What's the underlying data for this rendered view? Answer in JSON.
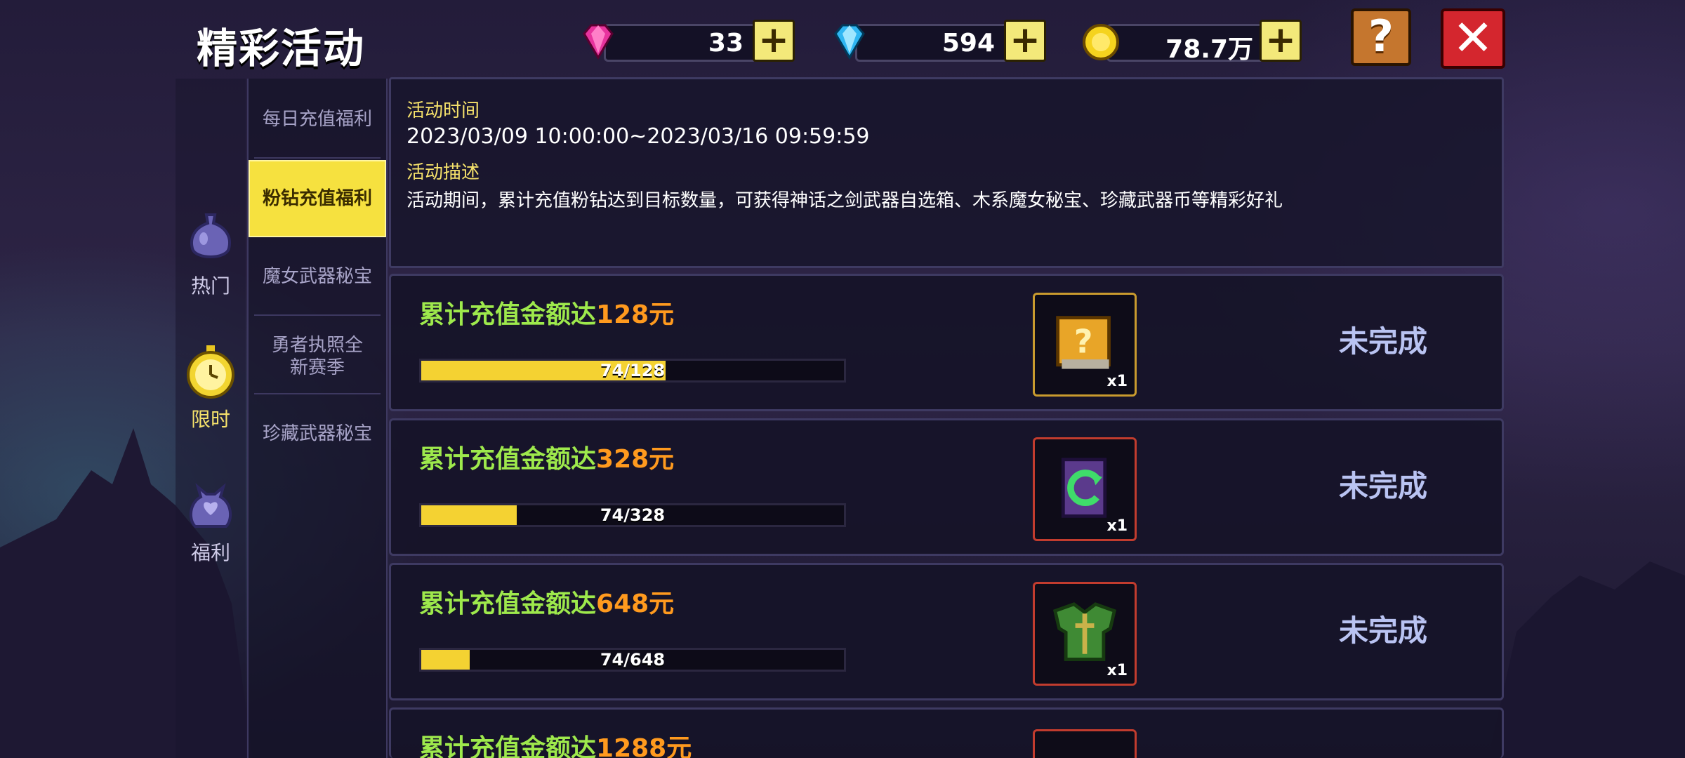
{
  "header": {
    "title": "精彩活动"
  },
  "currency": {
    "pink_diamond": {
      "value": "33",
      "icon": "pink-diamond-icon",
      "color": "#e8339e"
    },
    "blue_diamond": {
      "value": "594",
      "icon": "blue-diamond-icon",
      "color": "#2fb6f2"
    },
    "gold": {
      "value": "78.7万",
      "icon": "gold-coin-icon",
      "color": "#f5d31e"
    },
    "plus_glyph": "+"
  },
  "buttons": {
    "help": "?",
    "close": "✕"
  },
  "categories": [
    {
      "label": "热门",
      "icon": "potion-icon"
    },
    {
      "label": "限时",
      "icon": "pocket-watch-icon",
      "active": true
    },
    {
      "label": "福利",
      "icon": "gift-bag-icon"
    }
  ],
  "tabs": [
    {
      "label": "每日充值福利"
    },
    {
      "label": "粉钻充值福利",
      "active": true
    },
    {
      "label": "魔女武器秘宝"
    },
    {
      "label": "勇者执照全新赛季"
    },
    {
      "label": "珍藏武器秘宝"
    }
  ],
  "info": {
    "time_heading": "活动时间",
    "time_value": "2023/03/09 10:00:00~2023/03/16 09:59:59",
    "desc_heading": "活动描述",
    "desc_value": "活动期间，累计充值粉钻达到目标数量，可获得神话之剑武器自选箱、木系魔女秘宝、珍藏武器币等精彩好礼"
  },
  "tasks": [
    {
      "goal_prefix": "累计充值金额达",
      "amount": "128元",
      "progress_text": "74/128",
      "progress": 0.578,
      "item_icon": "mystery-chest-icon",
      "qty": "x1",
      "status": "未完成"
    },
    {
      "goal_prefix": "累计充值金额达",
      "amount": "328元",
      "progress_text": "74/328",
      "progress": 0.226,
      "item_icon": "green-rune-card-icon",
      "qty": "x1",
      "status": "未完成"
    },
    {
      "goal_prefix": "累计充值金额达",
      "amount": "648元",
      "progress_text": "74/648",
      "progress": 0.114,
      "item_icon": "jade-armor-icon",
      "qty": "x1",
      "status": "未完成"
    },
    {
      "goal_prefix": "累计充值金额达",
      "amount": "1288元"
    }
  ]
}
